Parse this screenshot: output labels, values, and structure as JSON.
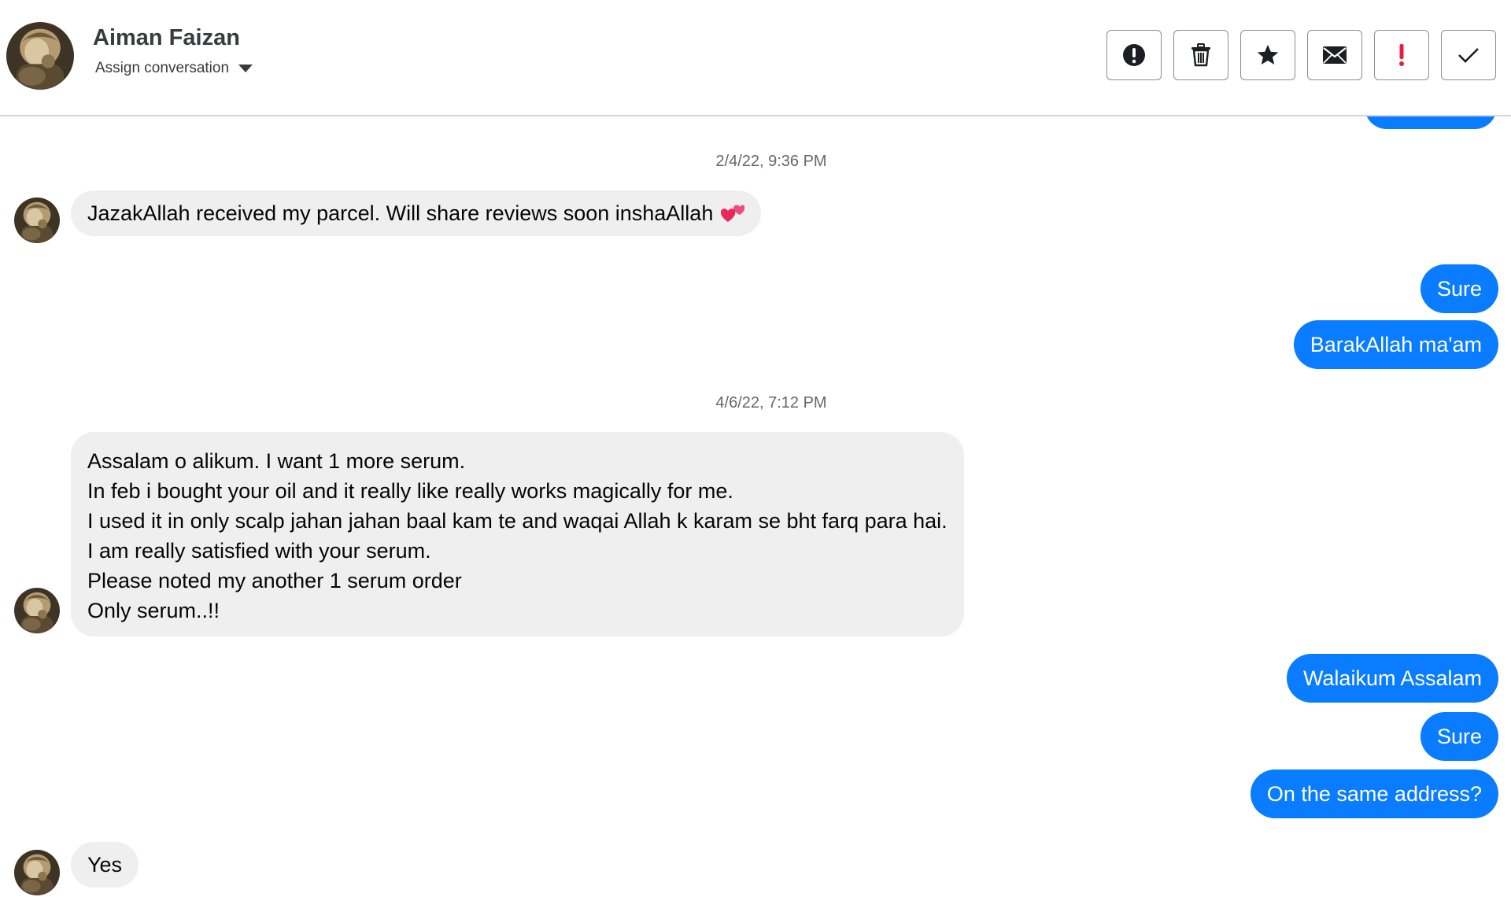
{
  "contact": {
    "name": "Aiman Faizan",
    "assign_label": "Assign conversation"
  },
  "toolbar": {
    "actions": [
      {
        "name": "alert-button",
        "icon": "exclamation-circle-icon"
      },
      {
        "name": "delete-button",
        "icon": "trash-icon"
      },
      {
        "name": "star-button",
        "icon": "star-icon"
      },
      {
        "name": "mark-unread-button",
        "icon": "envelope-icon"
      },
      {
        "name": "spam-button",
        "icon": "red-exclamation-icon"
      },
      {
        "name": "mark-done-button",
        "icon": "checkmark-icon"
      }
    ]
  },
  "colors": {
    "outgoing_bubble": "#0a7cff",
    "incoming_bubble": "#efefef",
    "spam_icon": "#e41e3f"
  },
  "thread": {
    "timestamp_1": "2/4/22, 9:36 PM",
    "msg_1": "JazakAllah received my parcel. Will share reviews soon inshaAllah",
    "msg_1_emoji": "two-hearts-emoji",
    "reply_1": "Sure",
    "reply_2": "BarakAllah ma'am",
    "timestamp_2": "4/6/22, 7:12 PM",
    "msg_2_lines": [
      "Assalam o alikum. I want 1 more serum.",
      "In feb i bought your oil and it really like really works magically for me.",
      "I used it in only scalp jahan jahan baal kam te and waqai Allah k karam se bht farq para hai.",
      "I am really satisfied with your serum.",
      "Please noted my another 1 serum order",
      "Only serum..!!"
    ],
    "reply_3": "Walaikum Assalam",
    "reply_4": "Sure",
    "reply_5": "On the same address?",
    "msg_3": "Yes"
  }
}
